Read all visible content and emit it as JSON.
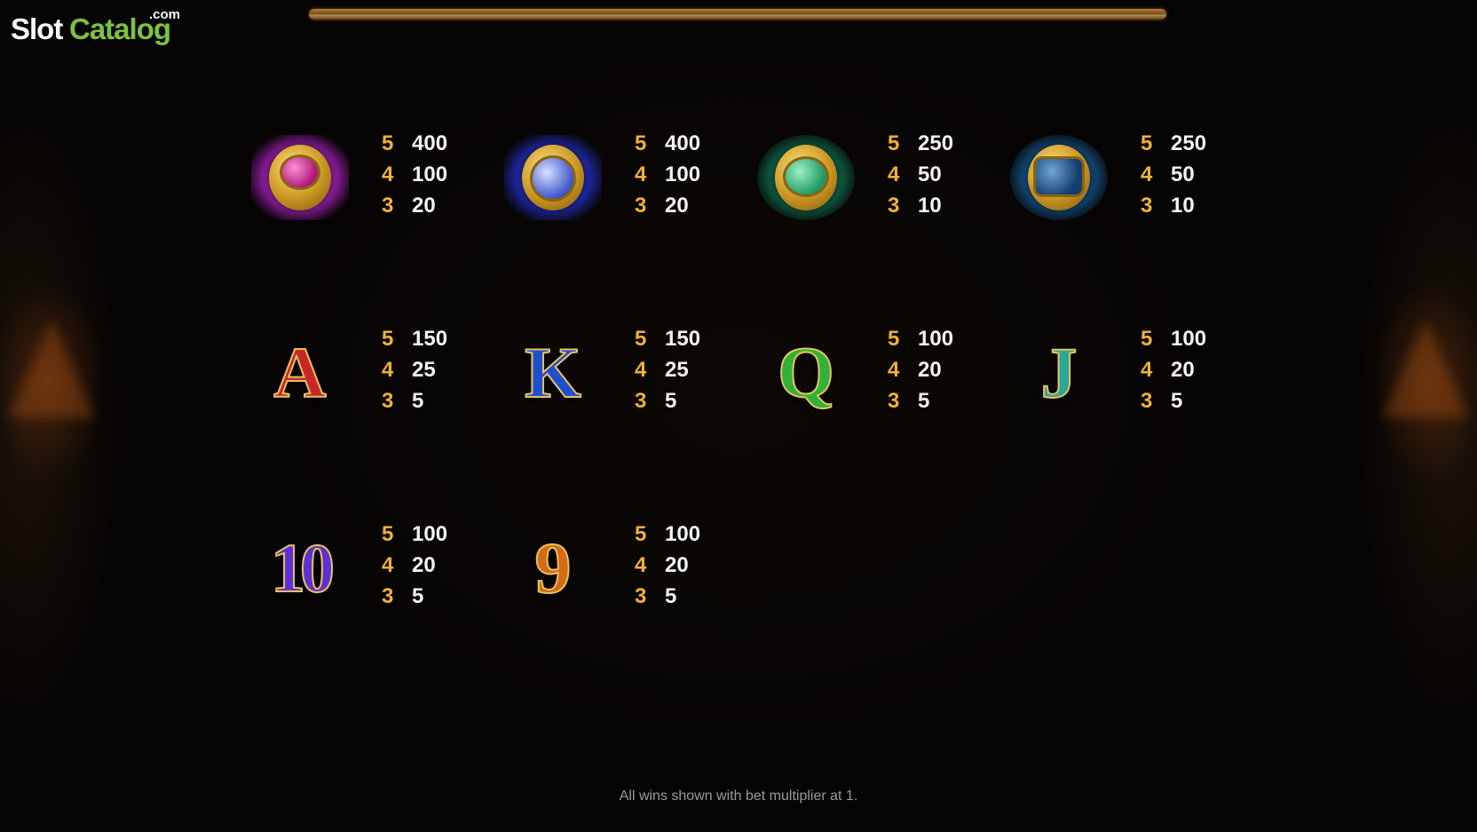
{
  "logo": {
    "part1": "Slot",
    "part2": "Catalog",
    "suffix": ".com"
  },
  "paytable": [
    {
      "symbol": "ring-pink-gem-icon",
      "pays": [
        {
          "count": "5",
          "value": "400"
        },
        {
          "count": "4",
          "value": "100"
        },
        {
          "count": "3",
          "value": "20"
        }
      ]
    },
    {
      "symbol": "ring-blue-pearl-icon",
      "pays": [
        {
          "count": "5",
          "value": "400"
        },
        {
          "count": "4",
          "value": "100"
        },
        {
          "count": "3",
          "value": "20"
        }
      ]
    },
    {
      "symbol": "ring-green-gem-icon",
      "pays": [
        {
          "count": "5",
          "value": "250"
        },
        {
          "count": "4",
          "value": "50"
        },
        {
          "count": "3",
          "value": "10"
        }
      ]
    },
    {
      "symbol": "ring-blue-gem-icon",
      "pays": [
        {
          "count": "5",
          "value": "250"
        },
        {
          "count": "4",
          "value": "50"
        },
        {
          "count": "3",
          "value": "10"
        }
      ]
    },
    {
      "symbol": "A",
      "pays": [
        {
          "count": "5",
          "value": "150"
        },
        {
          "count": "4",
          "value": "25"
        },
        {
          "count": "3",
          "value": "5"
        }
      ]
    },
    {
      "symbol": "K",
      "pays": [
        {
          "count": "5",
          "value": "150"
        },
        {
          "count": "4",
          "value": "25"
        },
        {
          "count": "3",
          "value": "5"
        }
      ]
    },
    {
      "symbol": "Q",
      "pays": [
        {
          "count": "5",
          "value": "100"
        },
        {
          "count": "4",
          "value": "20"
        },
        {
          "count": "3",
          "value": "5"
        }
      ]
    },
    {
      "symbol": "J",
      "pays": [
        {
          "count": "5",
          "value": "100"
        },
        {
          "count": "4",
          "value": "20"
        },
        {
          "count": "3",
          "value": "5"
        }
      ]
    },
    {
      "symbol": "10",
      "pays": [
        {
          "count": "5",
          "value": "100"
        },
        {
          "count": "4",
          "value": "20"
        },
        {
          "count": "3",
          "value": "5"
        }
      ]
    },
    {
      "symbol": "9",
      "pays": [
        {
          "count": "5",
          "value": "100"
        },
        {
          "count": "4",
          "value": "20"
        },
        {
          "count": "3",
          "value": "5"
        }
      ]
    }
  ],
  "footer": {
    "note": "All wins shown with bet multiplier at 1."
  },
  "colors": {
    "count": "#f2b035",
    "value": "#f4f4f4",
    "logo_green": "#7cc241"
  }
}
